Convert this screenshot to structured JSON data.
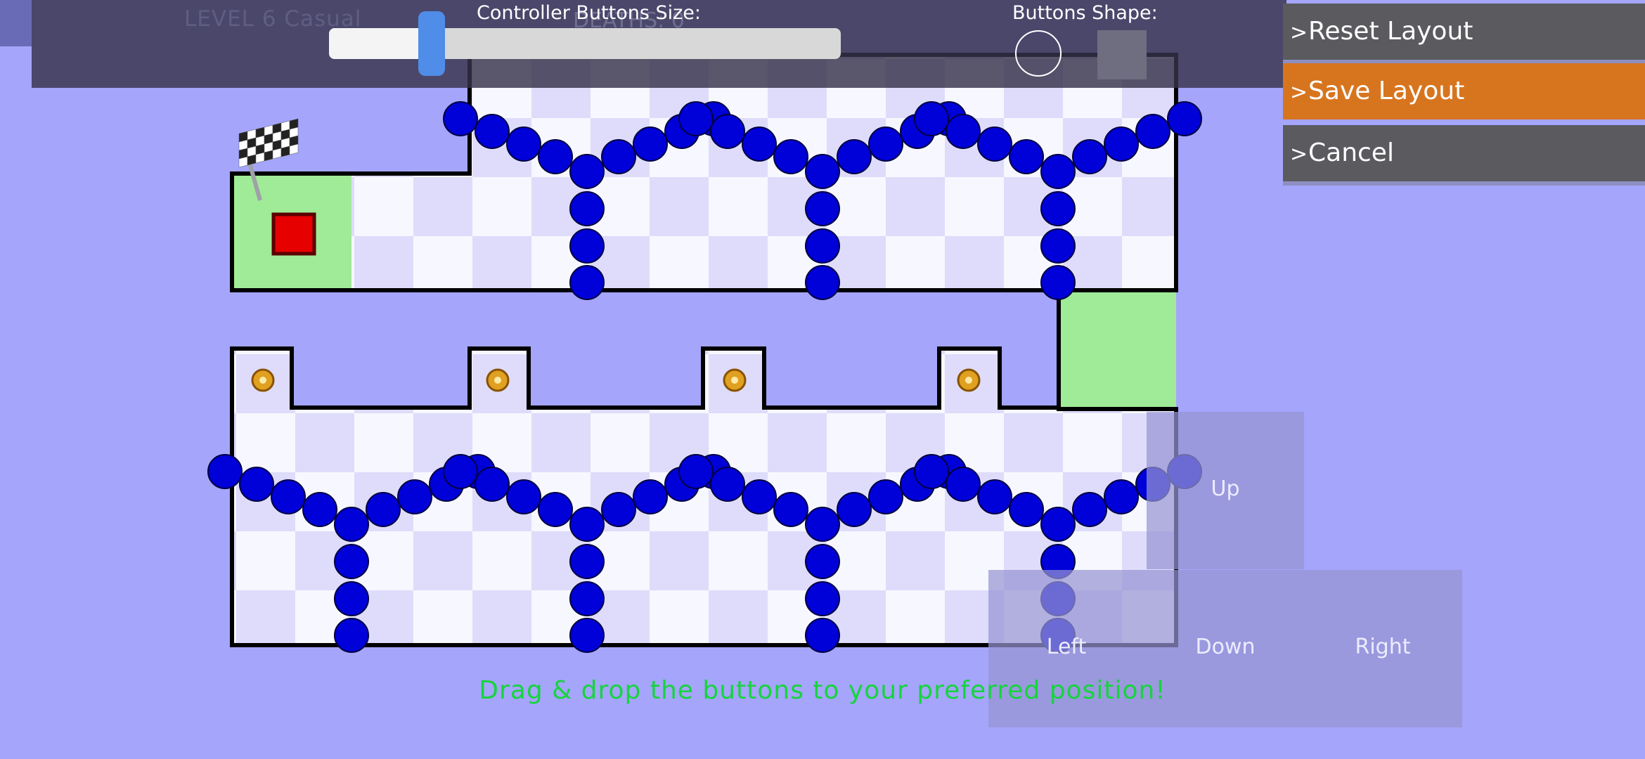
{
  "hud": {
    "level_text": "LEVEL 6 Casual",
    "deaths_text": "DEATHS: 0"
  },
  "settings": {
    "size_label": "Controller Buttons Size:",
    "size_value": 0.2,
    "shape_label": "Buttons Shape:",
    "shapes": [
      "circle",
      "square"
    ]
  },
  "menu": {
    "arrow": ">",
    "reset_label": "Reset Layout",
    "save_label": "Save Layout",
    "cancel_label": "Cancel"
  },
  "controls": {
    "up": "Up",
    "left": "Left",
    "down": "Down",
    "right": "Right"
  },
  "hint": "Drag & drop the buttons to your preferred position!",
  "level": {
    "start_icon": "checkered-flag-icon",
    "player": "red-square",
    "coins": 4,
    "enemy_count": 112
  },
  "colors": {
    "background": "#a4a5fb",
    "tile_light": "#f7f7ff",
    "tile_dark": "#dedcfa",
    "safe_zone": "#9feb98",
    "enemy": "#0000d8",
    "player": "#e60000",
    "coin": "#e0a020",
    "accent_orange": "#d7751f",
    "hint_text": "#16d43c"
  }
}
